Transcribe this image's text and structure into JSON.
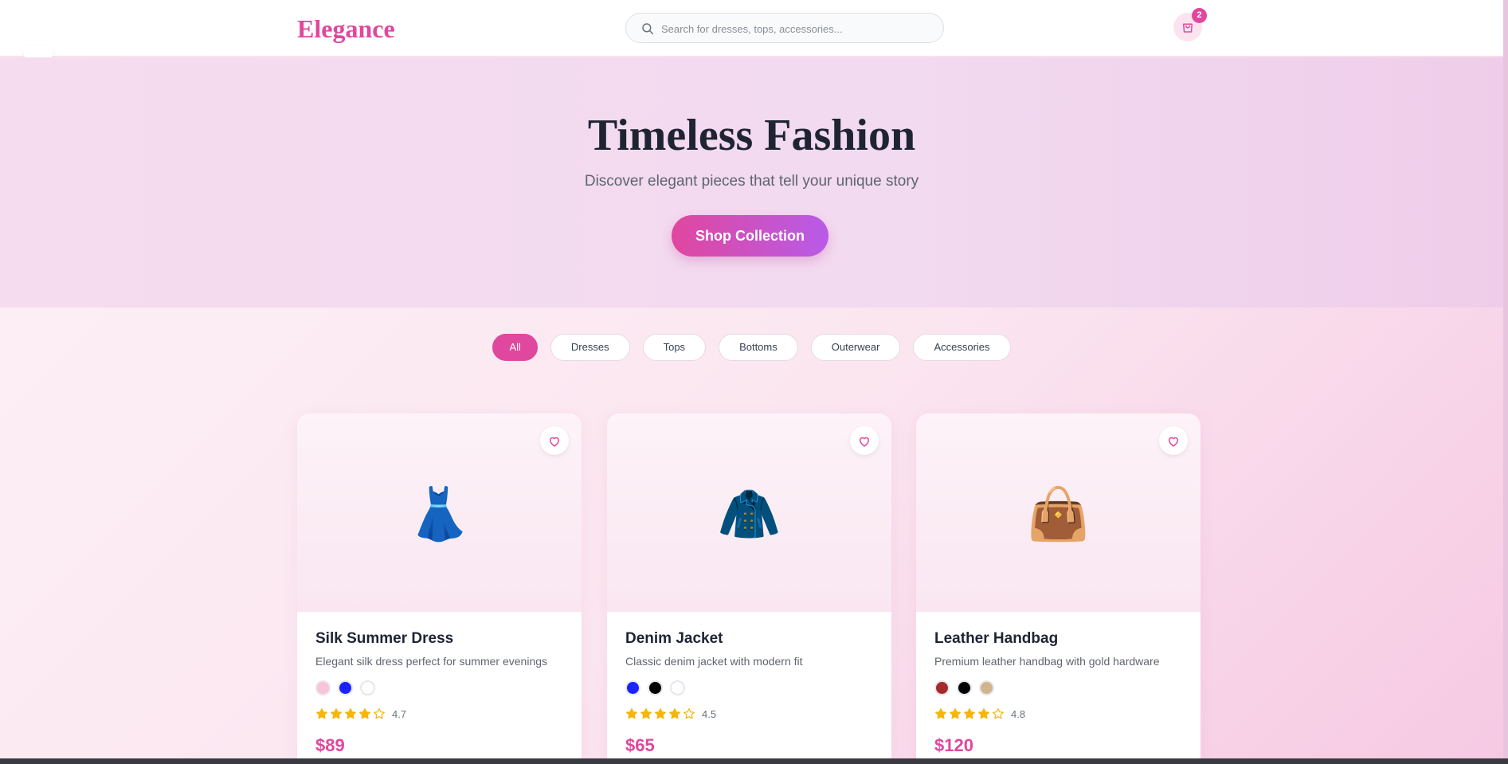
{
  "header": {
    "logo": "Elegance",
    "search_placeholder": "Search for dresses, tops, accessories...",
    "search_value": "",
    "cart_count": "2"
  },
  "hero": {
    "title": "Timeless Fashion",
    "subtitle": "Discover elegant pieces that tell your unique story",
    "cta": "Shop Collection"
  },
  "filters": [
    {
      "label": "All",
      "active": true
    },
    {
      "label": "Dresses",
      "active": false
    },
    {
      "label": "Tops",
      "active": false
    },
    {
      "label": "Bottoms",
      "active": false
    },
    {
      "label": "Outerwear",
      "active": false
    },
    {
      "label": "Accessories",
      "active": false
    }
  ],
  "products": [
    {
      "name": "Silk Summer Dress",
      "description": "Elegant silk dress perfect for summer evenings",
      "emoji": "👗",
      "colors": [
        "#f9c4d8",
        "#1a22ff",
        "#ffffff"
      ],
      "rating": 4.7,
      "rating_label": "4.7",
      "price": "$89"
    },
    {
      "name": "Denim Jacket",
      "description": "Classic denim jacket with modern fit",
      "emoji": "🧥",
      "colors": [
        "#1a22ff",
        "#000000",
        "#ffffff"
      ],
      "rating": 4.5,
      "rating_label": "4.5",
      "price": "$65"
    },
    {
      "name": "Leather Handbag",
      "description": "Premium leather handbag with gold hardware",
      "emoji": "👜",
      "colors": [
        "#a52a2a",
        "#000000",
        "#d2b48c"
      ],
      "rating": 4.8,
      "rating_label": "4.8",
      "price": "$120"
    }
  ],
  "theme": {
    "accent": "#e0479e",
    "accent_secondary": "#b85be8",
    "star": "#f5b50a"
  }
}
